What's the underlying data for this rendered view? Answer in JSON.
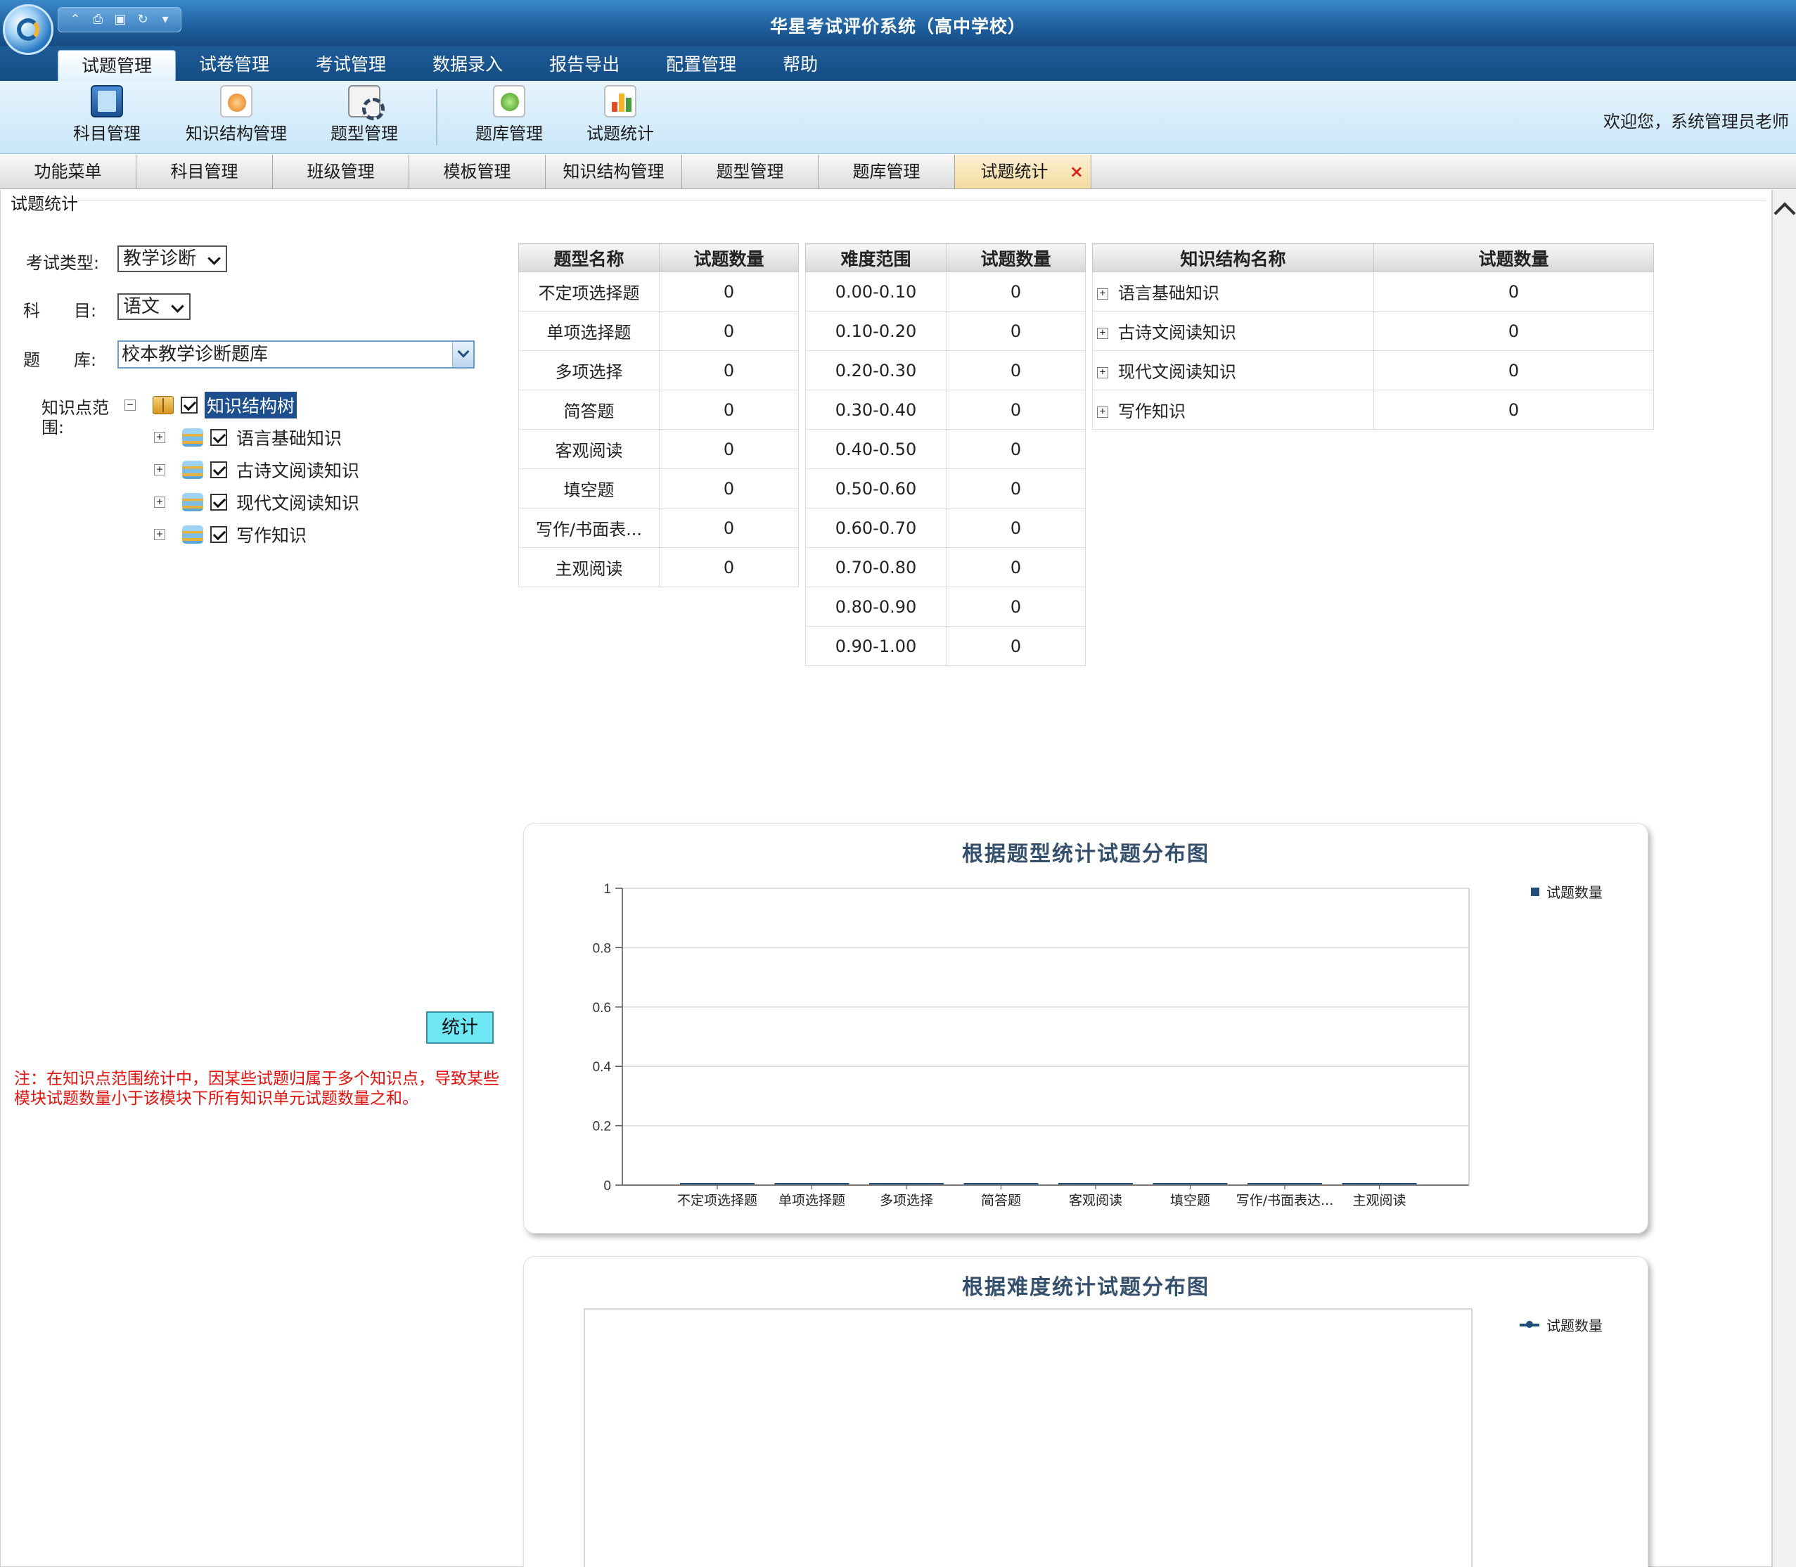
{
  "app": {
    "title": "华星考试评价系统（高中学校）"
  },
  "quick_access": [
    "up-icon",
    "print-icon",
    "save-icon",
    "refresh-icon",
    "dropdown-icon"
  ],
  "menu": [
    "试题管理",
    "试卷管理",
    "考试管理",
    "数据录入",
    "报告导出",
    "配置管理",
    "帮助"
  ],
  "ribbon": {
    "buttons": [
      "科目管理",
      "知识结构管理",
      "题型管理",
      "题库管理",
      "试题统计"
    ],
    "welcome": "欢迎您，系统管理员老师"
  },
  "doc_tabs": [
    "功能菜单",
    "科目管理",
    "班级管理",
    "模板管理",
    "知识结构管理",
    "题型管理",
    "题库管理",
    "试题统计"
  ],
  "section_title": "试题统计",
  "form": {
    "exam_type_label": "考试类型:",
    "exam_type_value": "教学诊断",
    "subject_label": "科　　目:",
    "subject_value": "语文",
    "bank_label": "题　　库:",
    "bank_value": "校本教学诊断题库",
    "range_label": "知识点范围:"
  },
  "tree": {
    "root": "知识结构树",
    "children": [
      "语言基础知识",
      "古诗文阅读知识",
      "现代文阅读知识",
      "写作知识"
    ]
  },
  "stat_button": "统计",
  "note": "注：在知识点范围统计中，因某些试题归属于多个知识点，导致某些模块试题数量小于该模块下所有知识单元试题数量之和。",
  "type_table": {
    "headers": [
      "题型名称",
      "试题数量"
    ],
    "rows": [
      [
        "不定项选择题",
        "0"
      ],
      [
        "单项选择题",
        "0"
      ],
      [
        "多项选择",
        "0"
      ],
      [
        "简答题",
        "0"
      ],
      [
        "客观阅读",
        "0"
      ],
      [
        "填空题",
        "0"
      ],
      [
        "写作/书面表...",
        "0"
      ],
      [
        "主观阅读",
        "0"
      ]
    ]
  },
  "difficulty_table": {
    "headers": [
      "难度范围",
      "试题数量"
    ],
    "rows": [
      [
        "0.00-0.10",
        "0"
      ],
      [
        "0.10-0.20",
        "0"
      ],
      [
        "0.20-0.30",
        "0"
      ],
      [
        "0.30-0.40",
        "0"
      ],
      [
        "0.40-0.50",
        "0"
      ],
      [
        "0.50-0.60",
        "0"
      ],
      [
        "0.60-0.70",
        "0"
      ],
      [
        "0.70-0.80",
        "0"
      ],
      [
        "0.80-0.90",
        "0"
      ],
      [
        "0.90-1.00",
        "0"
      ]
    ]
  },
  "knowledge_table": {
    "headers": [
      "知识结构名称",
      "试题数量"
    ],
    "rows": [
      [
        "语言基础知识",
        "0"
      ],
      [
        "古诗文阅读知识",
        "0"
      ],
      [
        "现代文阅读知识",
        "0"
      ],
      [
        "写作知识",
        "0"
      ]
    ]
  },
  "chart_data": [
    {
      "type": "bar",
      "title": "根据题型统计试题分布图",
      "categories": [
        "不定项选择题",
        "单项选择题",
        "多项选择",
        "简答题",
        "客观阅读",
        "填空题",
        "写作/书面表达...",
        "主观阅读"
      ],
      "series": [
        {
          "name": "试题数量",
          "values": [
            0,
            0,
            0,
            0,
            0,
            0,
            0,
            0
          ]
        }
      ],
      "ylim": [
        0,
        1
      ],
      "yticks": [
        "0",
        "0.2",
        "0.4",
        "0.6",
        "0.8",
        "1"
      ],
      "legend": "top-right",
      "color": "#1f4e79"
    },
    {
      "type": "line",
      "title": "根据难度统计试题分布图",
      "series": [
        {
          "name": "试题数量",
          "values": []
        }
      ],
      "legend": "top-right",
      "color": "#1f4e79"
    }
  ]
}
